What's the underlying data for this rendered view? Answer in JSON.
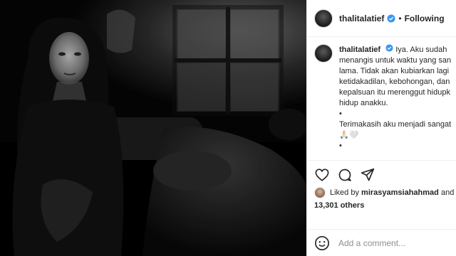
{
  "post": {
    "username": "thalitalatief",
    "verified_icon": "verified-badge-icon",
    "separator": "•",
    "follow_status": "Following"
  },
  "caption": {
    "username": "thalitalatief",
    "lines": [
      "Iya. Aku sudah",
      "menangis untuk waktu yang san",
      "lama. Tidak akan kubiarkan lagi",
      "ketidakadilan, kebohongan, dan",
      "kepalsuan itu merenggut hidupk",
      "hidup anakku."
    ],
    "bullet1": "•",
    "thanks": "Terimakasih aku menjadi sangat",
    "emoji": "🙏🏻🤍",
    "bullet2": "•"
  },
  "likes": {
    "prefix": "Liked by",
    "user": "mirasyamsiahahmad",
    "and": "and",
    "others": "13,301 others"
  },
  "comment": {
    "placeholder": "Add a comment..."
  },
  "icons": {
    "like": "heart-icon",
    "comment": "comment-icon",
    "share": "share-icon",
    "emoji": "emoji-icon"
  }
}
